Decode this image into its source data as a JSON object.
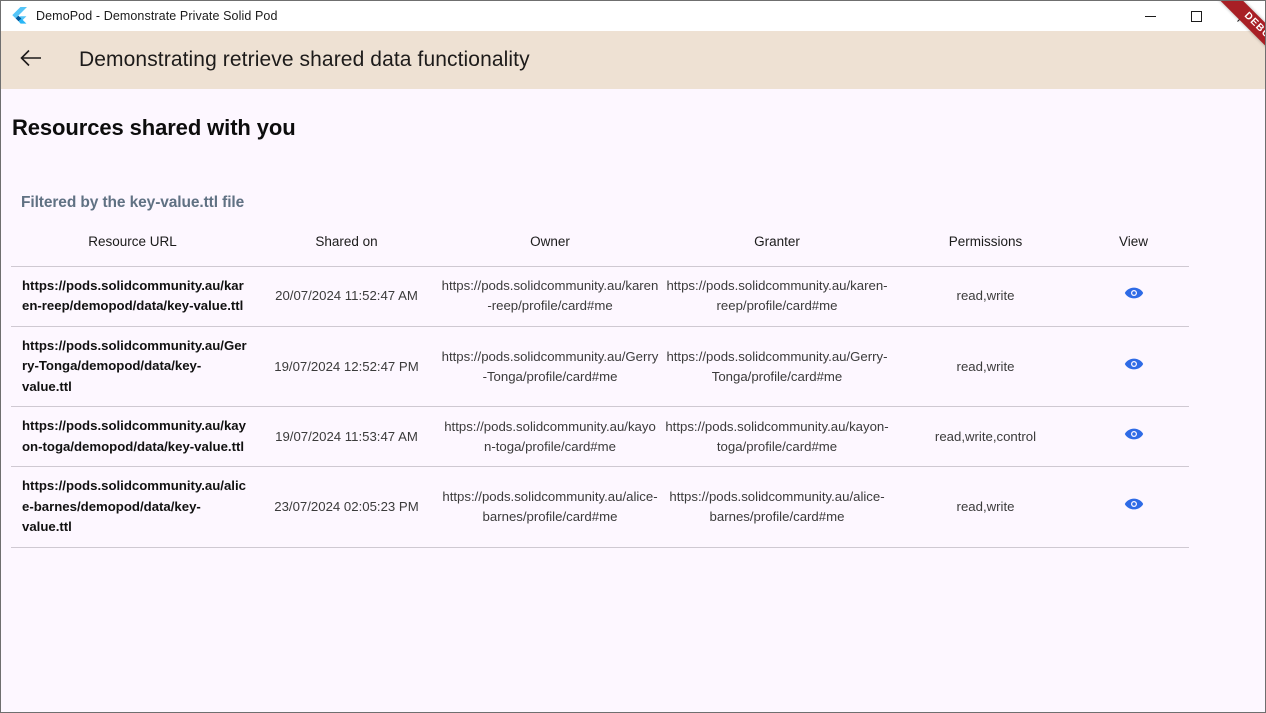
{
  "window": {
    "title": "DemoPod - Demonstrate Private Solid Pod",
    "logo_icon": "flutter-logo",
    "controls": {
      "minimize": "minimize-icon",
      "maximize": "maximize-icon",
      "close": "close-icon"
    }
  },
  "appbar": {
    "back_icon": "arrow-left-icon",
    "title": "Demonstrating retrieve shared data functionality"
  },
  "debug_banner": {
    "label": "DEBUG",
    "color": "#a81f25"
  },
  "page": {
    "title": "Resources shared with you",
    "filter_note": "Filtered by the key-value.ttl file",
    "accent_color": "#2e6be6",
    "background_color": "#fdf7ff",
    "appbar_color": "#eee1d3"
  },
  "table": {
    "columns": [
      "Resource URL",
      "Shared on",
      "Owner",
      "Granter",
      "Permissions",
      "View"
    ],
    "view_icon": "eye-icon",
    "rows": [
      {
        "resource_url": "https://pods.solidcommunity.au/karen-reep/demopod/data/key-value.ttl",
        "shared_on": "20/07/2024 11:52:47 AM",
        "owner": "https://pods.solidcommunity.au/karen-reep/profile/card#me",
        "granter": "https://pods.solidcommunity.au/karen-reep/profile/card#me",
        "permissions": "read,write"
      },
      {
        "resource_url": "https://pods.solidcommunity.au/Gerry-Tonga/demopod/data/key-value.ttl",
        "shared_on": "19/07/2024 12:52:47 PM",
        "owner": "https://pods.solidcommunity.au/Gerry-Tonga/profile/card#me",
        "granter": "https://pods.solidcommunity.au/Gerry-Tonga/profile/card#me",
        "permissions": "read,write"
      },
      {
        "resource_url": "https://pods.solidcommunity.au/kayon-toga/demopod/data/key-value.ttl",
        "shared_on": "19/07/2024 11:53:47 AM",
        "owner": "https://pods.solidcommunity.au/kayon-toga/profile/card#me",
        "granter": "https://pods.solidcommunity.au/kayon-toga/profile/card#me",
        "permissions": "read,write,control"
      },
      {
        "resource_url": "https://pods.solidcommunity.au/alice-barnes/demopod/data/key-value.ttl",
        "shared_on": "23/07/2024 02:05:23 PM",
        "owner": "https://pods.solidcommunity.au/alice-barnes/profile/card#me",
        "granter": "https://pods.solidcommunity.au/alice-barnes/profile/card#me",
        "permissions": "read,write"
      }
    ]
  }
}
